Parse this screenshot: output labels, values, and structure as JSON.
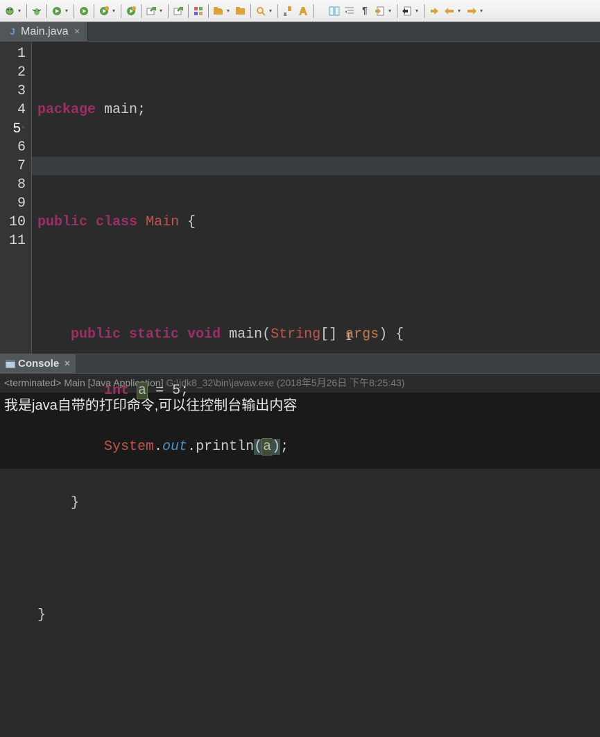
{
  "toolbar": {
    "icons": [
      "bug-menu",
      "bug",
      "run-menu",
      "run",
      "run-alt-menu",
      "run-alt",
      "external-menu",
      "external",
      "tools-group",
      "folder-open",
      "folder",
      "search-menu",
      "search",
      "paint",
      "columns",
      "indent",
      "pilcrow",
      "doc-in",
      "doc-out",
      "arrow-down-right",
      "arrow-left",
      "arrow-right"
    ]
  },
  "tab": {
    "icon": "J",
    "icon_color": "#6b9bd1",
    "title": "Main.java",
    "close": "✕"
  },
  "editor": {
    "lines": [
      {
        "num": 1
      },
      {
        "num": 2
      },
      {
        "num": 3
      },
      {
        "num": 4
      },
      {
        "num": 5,
        "marker": true
      },
      {
        "num": 6
      },
      {
        "num": 7,
        "highlight": true
      },
      {
        "num": 8
      },
      {
        "num": 9
      },
      {
        "num": 10
      },
      {
        "num": 11
      }
    ],
    "code": {
      "l1_package": "package",
      "l1_name": "main",
      "l3_public": "public",
      "l3_class": "class",
      "l3_Main": "Main",
      "l5_public": "public",
      "l5_static": "static",
      "l5_void": "void",
      "l5_main": "main",
      "l5_String": "String",
      "l5_args": "args",
      "l6_int": "int",
      "l6_a": "a",
      "l6_eq": "=",
      "l6_5": "5",
      "l7_System": "System",
      "l7_out": "out",
      "l7_println": "println",
      "l7_a": "a"
    }
  },
  "console": {
    "tab_label": "Console",
    "tab_close": "✕",
    "status_terminated": "<terminated>",
    "status_app": "Main [Java Application]",
    "status_path": "G:\\jdk8_32\\bin\\javaw.exe",
    "status_time": "(2018年5月26日 下午8:25:43)",
    "output": "我是java自带的打印命令,可以往控制台输出内容"
  }
}
